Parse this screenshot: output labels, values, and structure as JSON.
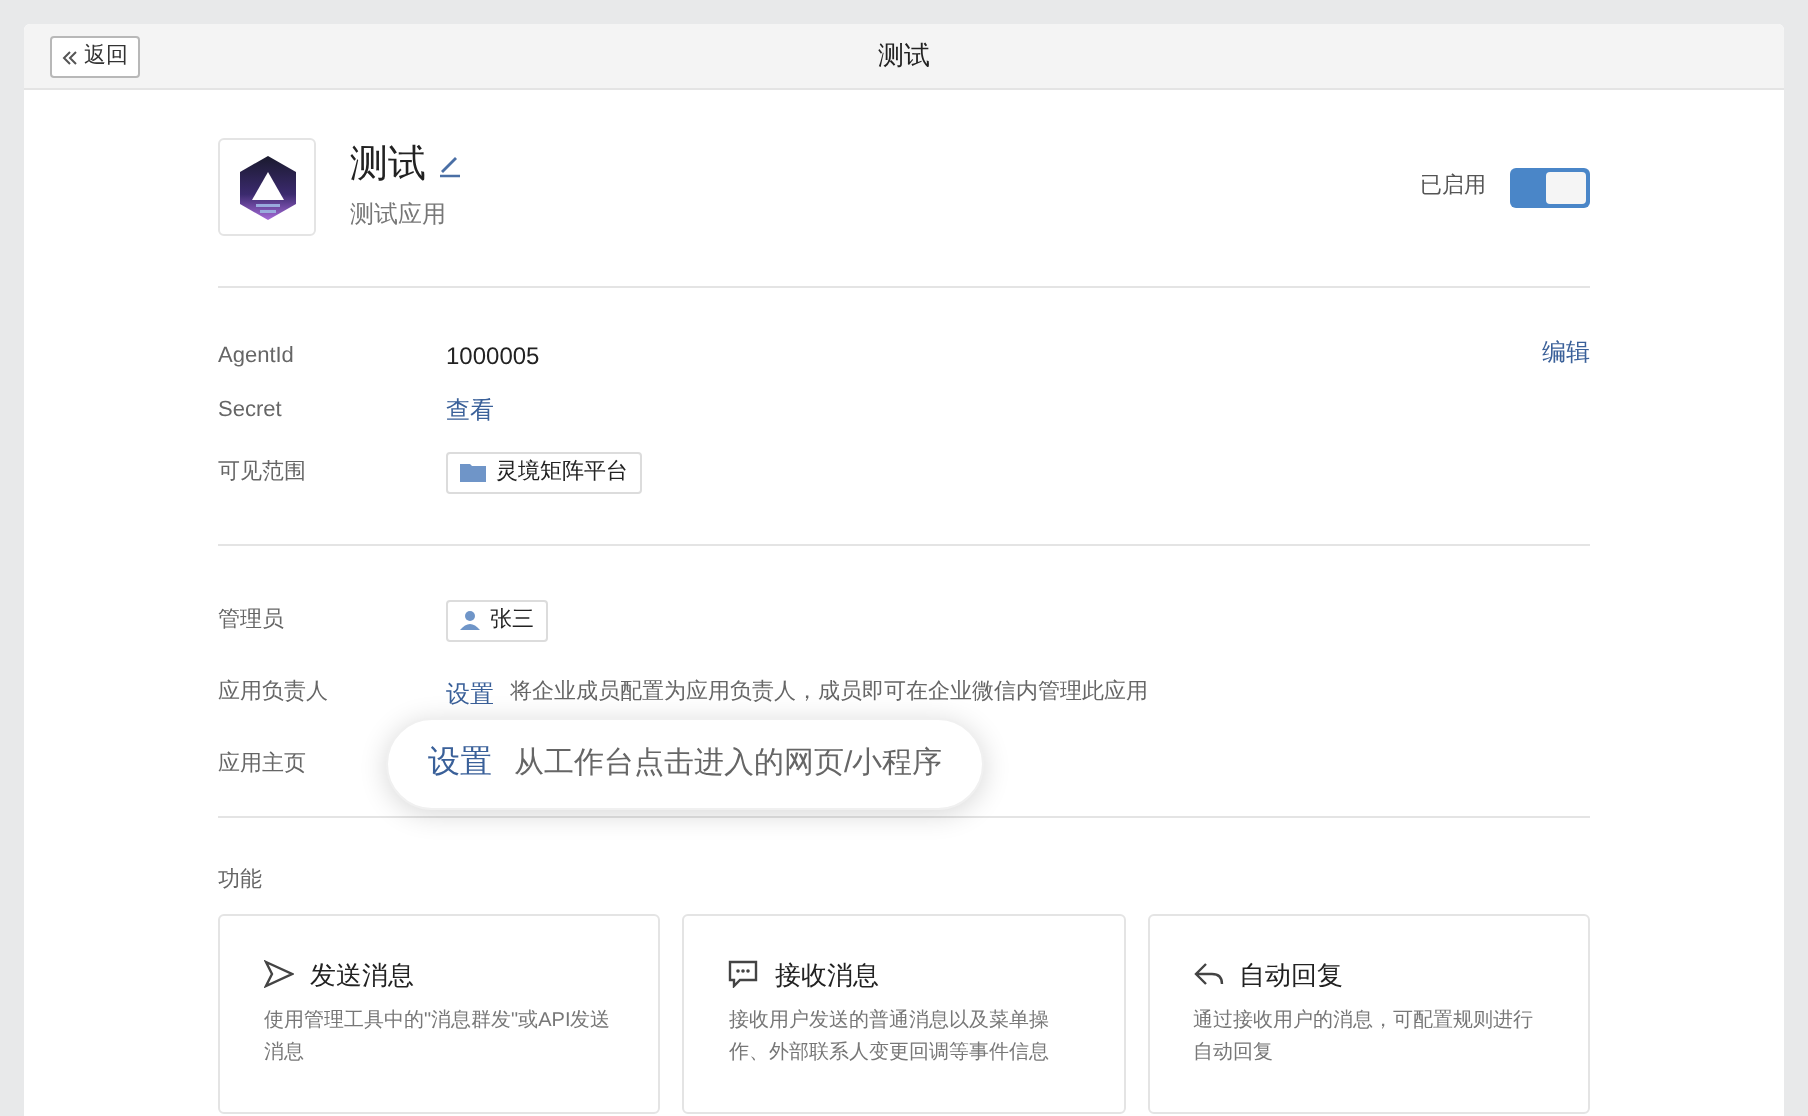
{
  "header": {
    "back_button": "返回",
    "title": "测试"
  },
  "app": {
    "name": "测试",
    "description": "测试应用",
    "status_label": "已启用",
    "enabled": true
  },
  "info_section": {
    "edit_link": "编辑",
    "rows": [
      {
        "label": "AgentId",
        "kind": "text",
        "value": "1000005"
      },
      {
        "label": "Secret",
        "kind": "link",
        "value": "查看"
      },
      {
        "label": "可见范围",
        "kind": "folder_tag",
        "value": "灵境矩阵平台"
      }
    ]
  },
  "admin_section": {
    "rows": [
      {
        "label": "管理员",
        "kind": "person_tag",
        "value": "张三"
      },
      {
        "label": "应用负责人",
        "kind": "link_hint",
        "value": "设置",
        "hint": "将企业成员配置为应用负责人，成员即可在企业微信内管理此应用",
        "highlighted": false
      },
      {
        "label": "应用主页",
        "kind": "link_hint",
        "value": "设置",
        "hint": "从工作台点击进入的网页/小程序",
        "highlighted": true
      }
    ]
  },
  "features": {
    "title": "功能",
    "cards": [
      {
        "kind": "send",
        "title": "发送消息",
        "description": "使用管理工具中的\"消息群发\"或API发送消息"
      },
      {
        "kind": "receive",
        "title": "接收消息",
        "description": "接收用户发送的普通消息以及菜单操作、外部联系人变更回调等事件信息"
      },
      {
        "kind": "reply",
        "title": "自动回复",
        "description": "通过接收用户的消息，可配置规则进行自动回复"
      }
    ]
  }
}
